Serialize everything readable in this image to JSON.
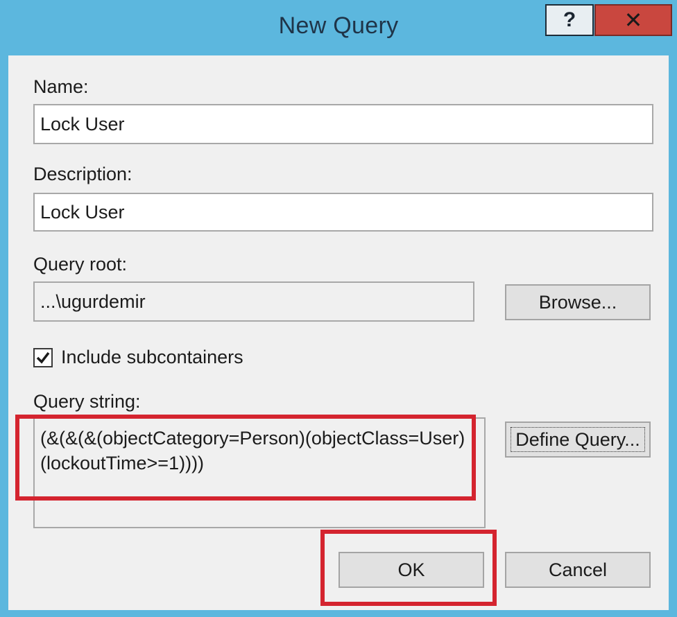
{
  "window": {
    "title": "New Query"
  },
  "titlebar": {
    "help_label": "?",
    "close_label": "✕"
  },
  "form": {
    "name_label": "Name:",
    "name_value": "Lock User",
    "description_label": "Description:",
    "description_value": "Lock User",
    "query_root_label": "Query root:",
    "query_root_value": "...\\ugurdemir",
    "browse_label": "Browse...",
    "include_subcontainers_label": "Include subcontainers",
    "include_subcontainers_checked": true,
    "query_string_label": "Query string:",
    "query_string_line1": "(&(&(&(objectCategory=Person)(objectClass=User)",
    "query_string_line2": "(lockoutTime>=1))))",
    "define_query_label": "Define Query...",
    "ok_label": "OK",
    "cancel_label": "Cancel"
  },
  "colors": {
    "frame": "#5cb7de",
    "close_button": "#c9473f",
    "highlight": "#d4242f"
  }
}
